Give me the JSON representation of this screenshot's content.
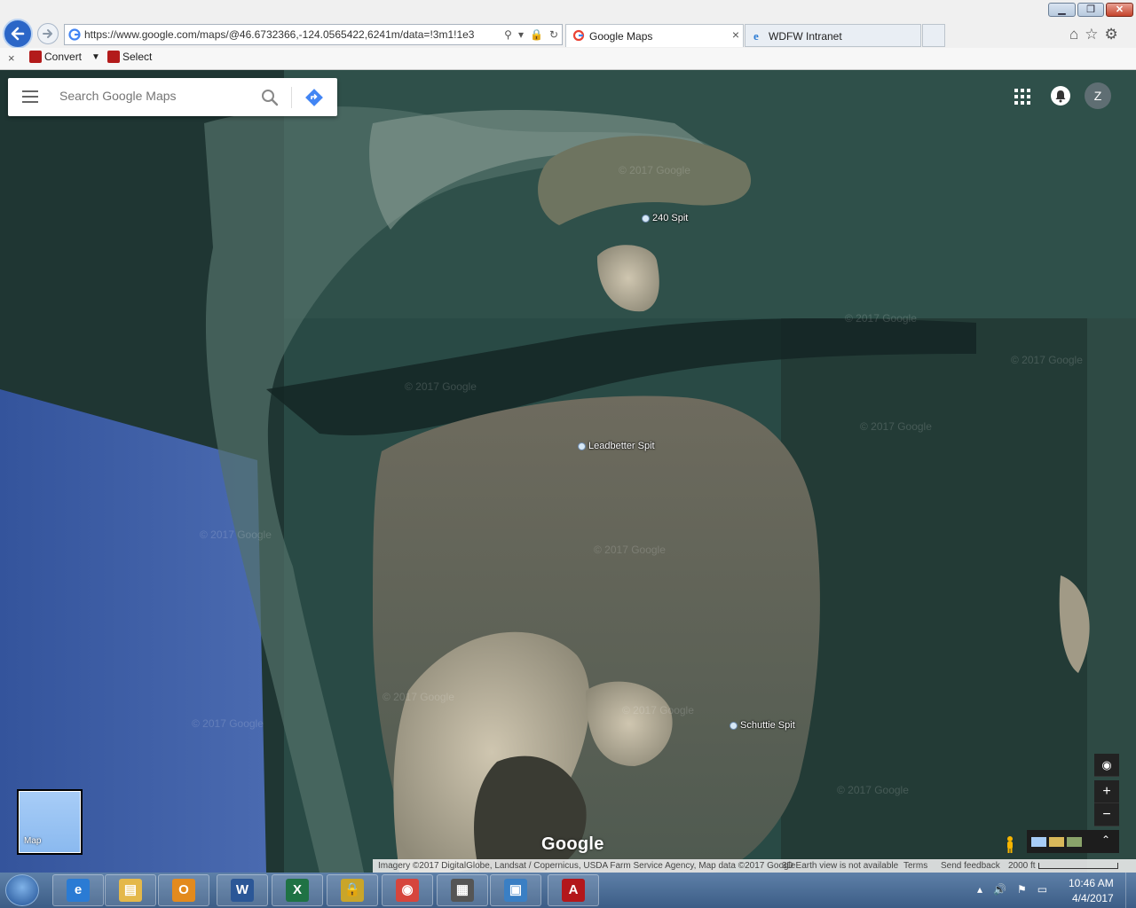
{
  "browser": {
    "address_url": "https://www.google.com/maps/@46.6732366,-124.0565422,6241m/data=!3m1!1e3",
    "tabs": [
      {
        "label": "Google Maps",
        "favicon": "google-g-icon",
        "active": true
      },
      {
        "label": "WDFW Intranet",
        "favicon": "ie-icon",
        "active": false
      }
    ],
    "tab_close_glyph": "×",
    "command_bar": {
      "close_glyph": "×",
      "convert_label": "Convert",
      "select_label": "Select"
    },
    "window_buttons": {
      "minimize": "▁",
      "maximize": "❐",
      "close": "✕"
    }
  },
  "maps": {
    "search_placeholder": "Search Google Maps",
    "avatar_letter": "Z",
    "places": [
      {
        "label": "240 Spit"
      },
      {
        "label": "Leadbetter Spit"
      },
      {
        "label": "Schuttie Spit"
      }
    ],
    "watermark_text": "© 2017 Google",
    "map_toggle_label": "Map",
    "zoom_in": "+",
    "zoom_out": "−",
    "logo_text": "Google",
    "footer": {
      "attribution": "Imagery ©2017 DigitalGlobe, Landsat / Copernicus, USDA Farm Service Agency, Map data ©2017 Google",
      "earth_note": "3D Earth view is not available",
      "terms": "Terms",
      "feedback": "Send feedback",
      "scale": "2000 ft"
    }
  },
  "taskbar": {
    "apps": [
      {
        "name": "internet-explorer",
        "icon": "ie-icon",
        "color": "#2a7bd4",
        "glyph": "e"
      },
      {
        "name": "file-explorer",
        "icon": "folder-icon",
        "color": "#e4b84a",
        "glyph": "▤"
      },
      {
        "name": "outlook",
        "icon": "outlook-icon",
        "color": "#e38a1d",
        "glyph": "O"
      },
      {
        "name": "word",
        "icon": "word-icon",
        "color": "#2b5797",
        "glyph": "W"
      },
      {
        "name": "excel",
        "icon": "excel-icon",
        "color": "#1f7244",
        "glyph": "X"
      },
      {
        "name": "security",
        "icon": "lock-icon",
        "color": "#c9a52a",
        "glyph": "🔒"
      },
      {
        "name": "chrome",
        "icon": "chrome-icon",
        "color": "#d6453d",
        "glyph": "◉"
      },
      {
        "name": "network",
        "icon": "network-icon",
        "color": "#555555",
        "glyph": "▦"
      },
      {
        "name": "photos",
        "icon": "photo-icon",
        "color": "#3a7fc4",
        "glyph": "▣"
      },
      {
        "name": "acrobat",
        "icon": "pdf-icon",
        "color": "#b3171b",
        "glyph": "A"
      }
    ],
    "clock_time": "10:46 AM",
    "clock_date": "4/4/2017"
  }
}
